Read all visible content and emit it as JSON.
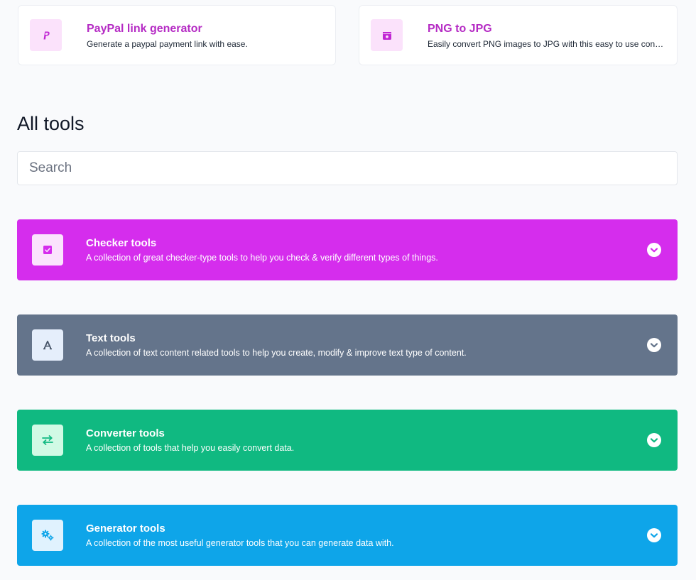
{
  "featured": [
    {
      "title": "PayPal link generator",
      "description": "Generate a paypal payment link with ease.",
      "icon": "paypal-icon"
    },
    {
      "title": "PNG to JPG",
      "description": "Easily convert PNG images to JPG with this easy to use converter.",
      "icon": "image-file-icon"
    }
  ],
  "all_tools": {
    "title": "All tools",
    "search_placeholder": "Search"
  },
  "categories": [
    {
      "title": "Checker tools",
      "description": "A collection of great checker-type tools to help you check & verify different types of things.",
      "icon": "checkbox-icon",
      "color": "#d52ded",
      "icon_bg": "#fbe3fd",
      "icon_color": "#d52ded"
    },
    {
      "title": "Text tools",
      "description": "A collection of text content related tools to help you create, modify & improve text type of content.",
      "icon": "letter-a-icon",
      "color": "#64748b",
      "icon_bg": "#e5eefb",
      "icon_color": "#475569"
    },
    {
      "title": "Converter tools",
      "description": "A collection of tools that help you easily convert data.",
      "icon": "swap-arrows-icon",
      "color": "#10b981",
      "icon_bg": "#d1fae5",
      "icon_color": "#10b981"
    },
    {
      "title": "Generator tools",
      "description": "A collection of the most useful generator tools that you can generate data with.",
      "icon": "cogs-icon",
      "color": "#0ea5e9",
      "icon_bg": "#e0f2fe",
      "icon_color": "#0ea5e9"
    }
  ],
  "accent_color": "#b52bc4"
}
